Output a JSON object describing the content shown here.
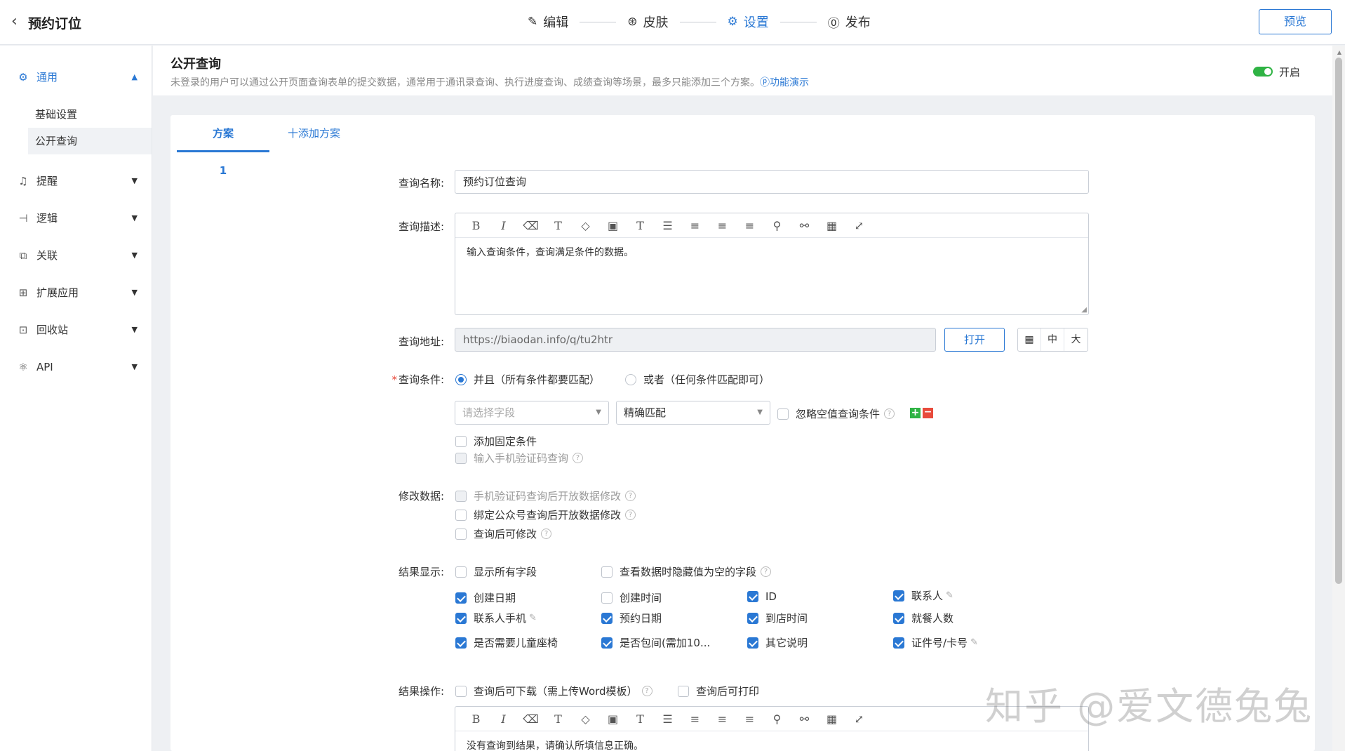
{
  "topbar": {
    "back_icon": "chevron-left-icon",
    "title": "预约订位",
    "steps": [
      {
        "label": "编辑",
        "icon": "edit-icon"
      },
      {
        "label": "皮肤",
        "icon": "palette-icon"
      },
      {
        "label": "设置",
        "icon": "gear-icon"
      },
      {
        "label": "发布",
        "icon": "publish-icon"
      }
    ],
    "preview": "预览"
  },
  "sidebar": {
    "groups": [
      {
        "label": "通用",
        "icon": "gear-icon",
        "open": true,
        "items": [
          "基础设置",
          "公开查询"
        ]
      },
      {
        "label": "提醒",
        "icon": "bell-icon"
      },
      {
        "label": "逻辑",
        "icon": "logic-icon"
      },
      {
        "label": "关联",
        "icon": "link-icon"
      },
      {
        "label": "扩展应用",
        "icon": "apps-icon"
      },
      {
        "label": "回收站",
        "icon": "trash-icon"
      },
      {
        "label": "API",
        "icon": "api-icon"
      }
    ]
  },
  "header": {
    "title": "公开查询",
    "desc": "未登录的用户可以通过公开页面查询表单的提交数据，通常用于通讯录查询、执行进度查询、成绩查询等场景，最多只能添加三个方案。",
    "demo": "ⓟ功能演示",
    "toggle_label": "开启",
    "accent": "#2a78d4",
    "toggle_color": "#2fb344"
  },
  "tabs": [
    "方案1",
    "十添加方案"
  ],
  "form": {
    "name_label": "查询名称:",
    "name_value": "预约订位查询",
    "desc_label": "查询描述:",
    "desc_value": "输入查询条件，查询满足条件的数据。",
    "url_label": "查询地址:",
    "url_value": "https://biaodan.info/q/tu2htr",
    "open_btn": "打开",
    "size_opts": [
      "中",
      "大"
    ],
    "cond_label": "查询条件:",
    "cond_and": "并且（所有条件都要匹配）",
    "cond_or": "或者（任何条件匹配即可）",
    "field_placeholder": "请选择字段",
    "match_value": "精确匹配",
    "ignore_empty": "忽略空值查询条件",
    "add_fixed": "添加固定条件",
    "sms_query": "输入手机验证码查询",
    "modify_label": "修改数据:",
    "modify_opts": [
      "手机验证码查询后开放数据修改",
      "绑定公众号查询后开放数据修改",
      "查询后可修改"
    ],
    "result_label": "结果显示:",
    "show_all": "显示所有字段",
    "hide_empty": "查看数据时隐藏值为空的字段",
    "fields": [
      {
        "label": "创建日期",
        "checked": true
      },
      {
        "label": "创建时间",
        "checked": false
      },
      {
        "label": "ID",
        "checked": true
      },
      {
        "label": "联系人",
        "checked": true,
        "pen": true
      },
      {
        "label": "联系人手机",
        "checked": true,
        "pen": true
      },
      {
        "label": "预约日期",
        "checked": true
      },
      {
        "label": "到店时间",
        "checked": true
      },
      {
        "label": "就餐人数",
        "checked": true
      },
      {
        "label": "是否需要儿童座椅",
        "checked": true
      },
      {
        "label": "是否包间(需加10...",
        "checked": true
      },
      {
        "label": "其它说明",
        "checked": true
      },
      {
        "label": "证件号/卡号",
        "checked": true,
        "pen": true
      }
    ],
    "action_label": "结果操作:",
    "download": "查询后可下载（需上传Word模板）",
    "print": "查询后可打印",
    "no_result": "没有查询到结果，请确认所填信息正确。"
  },
  "watermark": "知乎 @爱文德兔兔"
}
